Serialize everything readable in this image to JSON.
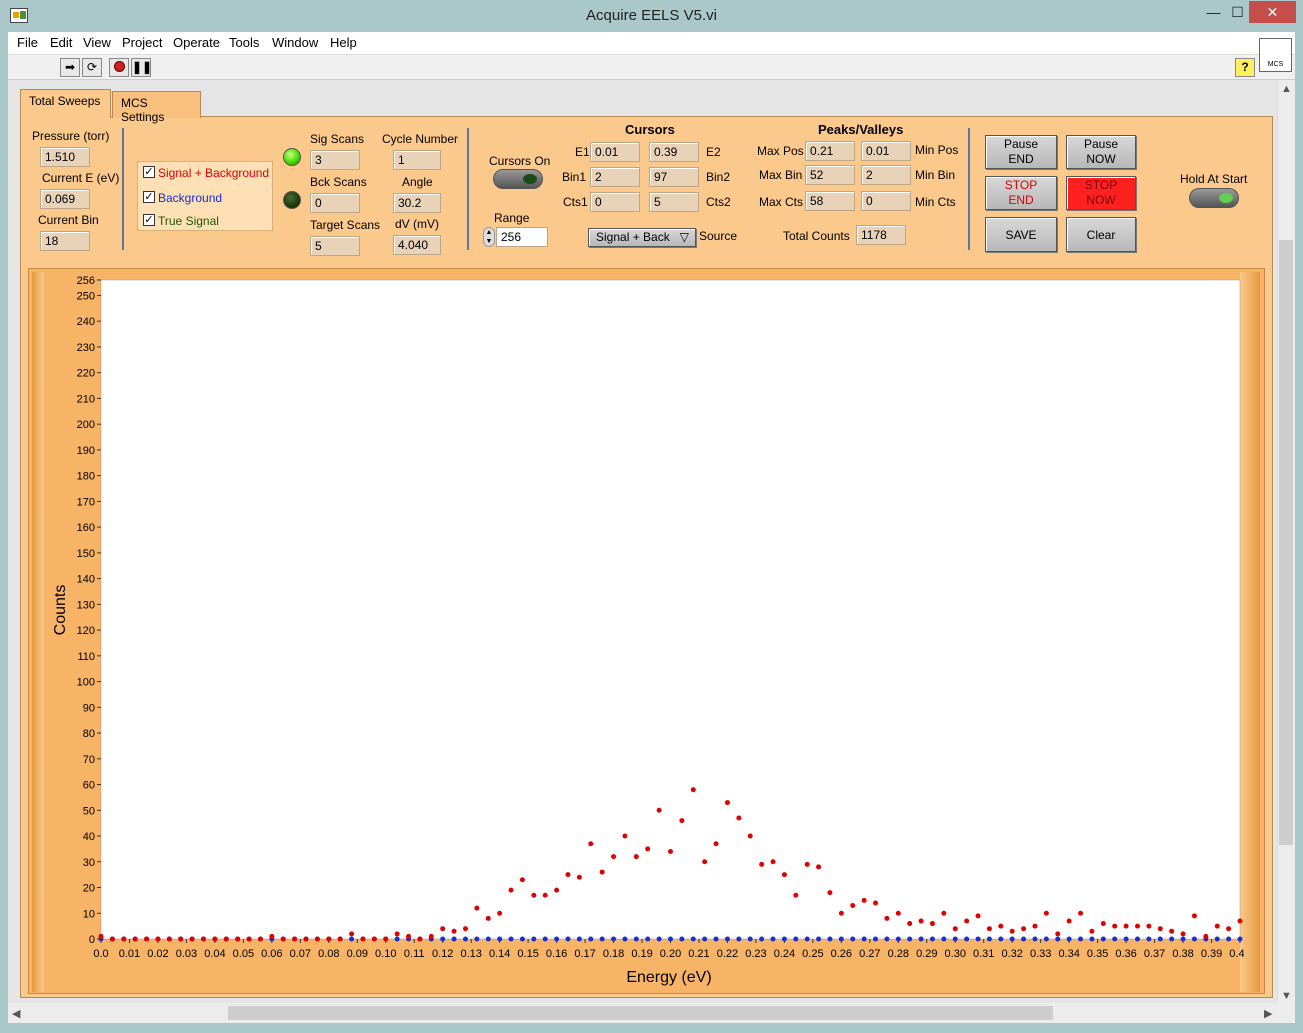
{
  "window": {
    "title": "Acquire EELS V5.vi",
    "min": "—",
    "max": "☐",
    "close": "✕"
  },
  "menu": [
    "File",
    "Edit",
    "View",
    "Project",
    "Operate",
    "Tools",
    "Window",
    "Help"
  ],
  "toolbar": {
    "help": "?",
    "mcs": "MCS"
  },
  "tabs": [
    {
      "label": "Total Sweeps"
    },
    {
      "label": "MCS Settings"
    }
  ],
  "status": {
    "pressure_label": "Pressure (torr)",
    "pressure": "1.510",
    "current_e_label": "Current E (eV)",
    "current_e": "0.069",
    "current_bin_label": "Current Bin",
    "current_bin": "18"
  },
  "legend": {
    "items": [
      {
        "label": "Signal + Background",
        "color": "#e00000",
        "checked": "✓"
      },
      {
        "label": "Background",
        "color": "#1a2fcf",
        "checked": "✓"
      },
      {
        "label": "True Signal",
        "color": "#1e5a00",
        "checked": "✓"
      }
    ]
  },
  "scans": {
    "sig_label": "Sig Scans",
    "sig": "3",
    "bck_label": "Bck Scans",
    "bck": "0",
    "target_label": "Target Scans",
    "target": "5",
    "cycle_label": "Cycle Number",
    "cycle": "1",
    "angle_label": "Angle",
    "angle": "30.2",
    "dv_label": "dV (mV)",
    "dv": "4.040",
    "sig_led_color": "#44dd00",
    "bck_led_color": "#1a3a0a"
  },
  "cursors": {
    "on_label": "Cursors On",
    "range_label": "Range",
    "range": "256",
    "title": "Cursors",
    "e1_label": "E1",
    "e1": "0.01",
    "e2": "0.39",
    "e2_label": "E2",
    "bin1_label": "Bin1",
    "bin1": "2",
    "bin2": "97",
    "bin2_label": "Bin2",
    "cts1_label": "Cts1",
    "cts1": "0",
    "cts2": "5",
    "cts2_label": "Cts2",
    "source_value": "Signal + Back",
    "source_label": "Source"
  },
  "peaks": {
    "title": "Peaks/Valleys",
    "max_pos_label": "Max Pos",
    "max_pos": "0.21",
    "min_pos": "0.01",
    "min_pos_label": "Min Pos",
    "max_bin_label": "Max Bin",
    "max_bin": "52",
    "min_bin": "2",
    "min_bin_label": "Min Bin",
    "max_cts_label": "Max Cts",
    "max_cts": "58",
    "min_cts": "0",
    "min_cts_label": "Min Cts",
    "total_label": "Total Counts",
    "total": "1178"
  },
  "buttons": {
    "pause_end": "Pause\nEND",
    "pause_now": "Pause\nNOW",
    "stop_end": "STOP\nEND",
    "stop_now": "STOP\nNOW",
    "save": "SAVE",
    "clear": "Clear",
    "hold_label": "Hold At Start"
  },
  "chart_data": {
    "type": "scatter",
    "xlabel": "Energy (eV)",
    "ylabel": "Counts",
    "xlim": [
      0.0,
      0.4
    ],
    "ylim": [
      0,
      256
    ],
    "x_ticks": [
      "0.0",
      "0.01",
      "0.02",
      "0.03",
      "0.04",
      "0.05",
      "0.06",
      "0.07",
      "0.08",
      "0.09",
      "0.10",
      "0.11",
      "0.12",
      "0.13",
      "0.14",
      "0.15",
      "0.16",
      "0.17",
      "0.18",
      "0.19",
      "0.20",
      "0.21",
      "0.22",
      "0.23",
      "0.24",
      "0.25",
      "0.26",
      "0.27",
      "0.28",
      "0.29",
      "0.30",
      "0.31",
      "0.32",
      "0.33",
      "0.34",
      "0.35",
      "0.36",
      "0.37",
      "0.38",
      "0.39",
      "0.40"
    ],
    "y_ticks": [
      0,
      10,
      20,
      30,
      40,
      50,
      60,
      70,
      80,
      90,
      100,
      110,
      120,
      130,
      140,
      150,
      160,
      170,
      180,
      190,
      200,
      210,
      220,
      230,
      240,
      250,
      256
    ],
    "series": [
      {
        "name": "Signal + Background",
        "color": "#e00000",
        "x": [
          0.0,
          0.004,
          0.008,
          0.012,
          0.016,
          0.02,
          0.024,
          0.028,
          0.032,
          0.036,
          0.04,
          0.044,
          0.048,
          0.052,
          0.056,
          0.06,
          0.064,
          0.068,
          0.072,
          0.076,
          0.08,
          0.084,
          0.088,
          0.092,
          0.096,
          0.1,
          0.104,
          0.108,
          0.112,
          0.116,
          0.12,
          0.124,
          0.128,
          0.132,
          0.136,
          0.14,
          0.144,
          0.148,
          0.152,
          0.156,
          0.16,
          0.164,
          0.168,
          0.172,
          0.176,
          0.18,
          0.184,
          0.188,
          0.192,
          0.196,
          0.2,
          0.204,
          0.208,
          0.212,
          0.216,
          0.22,
          0.224,
          0.228,
          0.232,
          0.236,
          0.24,
          0.244,
          0.248,
          0.252,
          0.256,
          0.26,
          0.264,
          0.268,
          0.272,
          0.276,
          0.28,
          0.284,
          0.288,
          0.292,
          0.296,
          0.3,
          0.304,
          0.308,
          0.312,
          0.316,
          0.32,
          0.324,
          0.328,
          0.332,
          0.336,
          0.34,
          0.344,
          0.348,
          0.352,
          0.356,
          0.36,
          0.364,
          0.368,
          0.372,
          0.376,
          0.38,
          0.384,
          0.388,
          0.392,
          0.396,
          0.4
        ],
        "y": [
          1,
          0,
          0,
          0,
          0,
          0,
          0,
          0,
          0,
          0,
          0,
          0,
          0,
          0,
          0,
          1,
          0,
          0,
          0,
          0,
          0,
          0,
          2,
          0,
          0,
          0,
          2,
          1,
          0,
          1,
          4,
          3,
          4,
          12,
          8,
          10,
          19,
          23,
          17,
          17,
          19,
          25,
          24,
          37,
          26,
          32,
          40,
          32,
          35,
          50,
          34,
          46,
          58,
          30,
          37,
          53,
          47,
          40,
          29,
          30,
          25,
          17,
          29,
          28,
          18,
          10,
          13,
          15,
          14,
          8,
          10,
          6,
          7,
          6,
          10,
          4,
          7,
          9,
          4,
          5,
          3,
          4,
          5,
          10,
          2,
          7,
          10,
          3,
          6,
          5,
          5,
          5,
          5,
          4,
          3,
          2,
          9,
          1,
          5,
          4,
          7
        ]
      },
      {
        "name": "Background",
        "color": "#1a2fcf",
        "x": [
          0.0,
          0.004,
          0.008,
          0.012,
          0.016,
          0.02,
          0.024,
          0.028,
          0.032,
          0.036,
          0.04,
          0.044,
          0.048,
          0.052,
          0.056,
          0.06,
          0.064,
          0.068,
          0.072,
          0.076,
          0.08,
          0.084,
          0.088,
          0.092,
          0.096,
          0.1,
          0.104,
          0.108,
          0.112,
          0.116,
          0.12,
          0.124,
          0.128,
          0.132,
          0.136,
          0.14,
          0.144,
          0.148,
          0.152,
          0.156,
          0.16,
          0.164,
          0.168,
          0.172,
          0.176,
          0.18,
          0.184,
          0.188,
          0.192,
          0.196,
          0.2,
          0.204,
          0.208,
          0.212,
          0.216,
          0.22,
          0.224,
          0.228,
          0.232,
          0.236,
          0.24,
          0.244,
          0.248,
          0.252,
          0.256,
          0.26,
          0.264,
          0.268,
          0.272,
          0.276,
          0.28,
          0.284,
          0.288,
          0.292,
          0.296,
          0.3,
          0.304,
          0.308,
          0.312,
          0.316,
          0.32,
          0.324,
          0.328,
          0.332,
          0.336,
          0.34,
          0.344,
          0.348,
          0.352,
          0.356,
          0.36,
          0.364,
          0.368,
          0.372,
          0.376,
          0.38,
          0.384,
          0.388,
          0.392,
          0.396,
          0.4
        ],
        "y": [
          0,
          0,
          0,
          0,
          0,
          0,
          0,
          0,
          0,
          0,
          0,
          0,
          0,
          0,
          0,
          0,
          0,
          0,
          0,
          0,
          0,
          0,
          0,
          0,
          0,
          0,
          0,
          0,
          0,
          0,
          0,
          0,
          0,
          0,
          0,
          0,
          0,
          0,
          0,
          0,
          0,
          0,
          0,
          0,
          0,
          0,
          0,
          0,
          0,
          0,
          0,
          0,
          0,
          0,
          0,
          0,
          0,
          0,
          0,
          0,
          0,
          0,
          0,
          0,
          0,
          0,
          0,
          0,
          0,
          0,
          0,
          0,
          0,
          0,
          0,
          0,
          0,
          0,
          0,
          0,
          0,
          0,
          0,
          0,
          0,
          0,
          0,
          0,
          0,
          0,
          0,
          0,
          0,
          0,
          0,
          0,
          0,
          0,
          0,
          0,
          0
        ]
      }
    ]
  }
}
